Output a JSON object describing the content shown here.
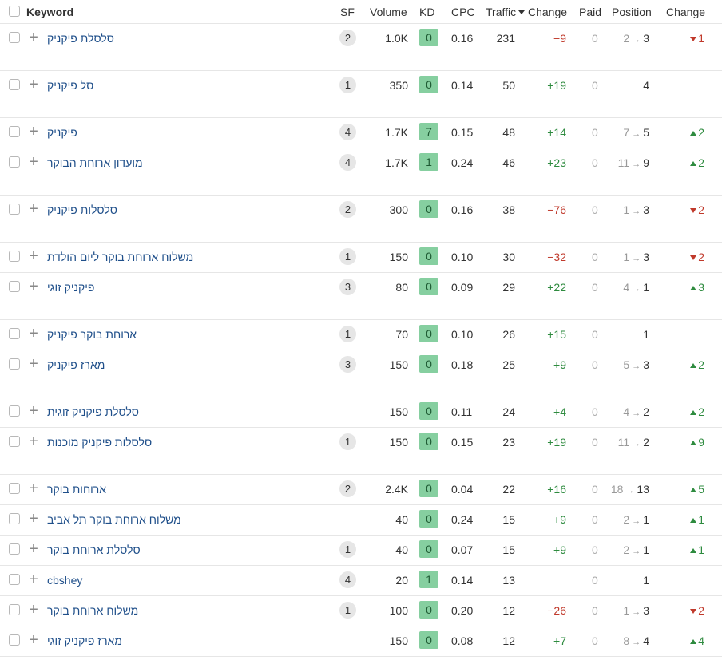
{
  "headers": {
    "keyword": "Keyword",
    "sf": "SF",
    "volume": "Volume",
    "kd": "KD",
    "cpc": "CPC",
    "traffic": "Traffic",
    "change": "Change",
    "paid": "Paid",
    "position": "Position",
    "position_change": "Change"
  },
  "colors": {
    "kd_badge": "#86cfa0",
    "positive": "#2e8b3f",
    "negative": "#c0392b",
    "link": "#1f4f8a"
  },
  "rows": [
    {
      "keyword": "סלסלת פיקניק",
      "sf": "2",
      "volume": "1.0K",
      "kd": "0",
      "cpc": "0.16",
      "traffic": "231",
      "change": "−9",
      "change_dir": "neg",
      "paid": "0",
      "pos_old": "2",
      "pos_new": "3",
      "pos_change": "1",
      "pos_change_dir": "down",
      "height": 59
    },
    {
      "keyword": "סל פיקניק",
      "sf": "1",
      "volume": "350",
      "kd": "0",
      "cpc": "0.14",
      "traffic": "50",
      "change": "+19",
      "change_dir": "pos",
      "paid": "0",
      "pos_old": "",
      "pos_new": "4",
      "pos_change": "",
      "pos_change_dir": "",
      "height": 59
    },
    {
      "keyword": "פיקניק",
      "sf": "4",
      "volume": "1.7K",
      "kd": "7",
      "cpc": "0.15",
      "traffic": "48",
      "change": "+14",
      "change_dir": "pos",
      "paid": "0",
      "pos_old": "7",
      "pos_new": "5",
      "pos_change": "2",
      "pos_change_dir": "up",
      "height": 38
    },
    {
      "keyword": "מועדון ארוחת הבוקר",
      "sf": "4",
      "volume": "1.7K",
      "kd": "1",
      "cpc": "0.24",
      "traffic": "46",
      "change": "+23",
      "change_dir": "pos",
      "paid": "0",
      "pos_old": "11",
      "pos_new": "9",
      "pos_change": "2",
      "pos_change_dir": "up",
      "height": 59
    },
    {
      "keyword": "סלסלות פיקניק",
      "sf": "2",
      "volume": "300",
      "kd": "0",
      "cpc": "0.16",
      "traffic": "38",
      "change": "−76",
      "change_dir": "neg",
      "paid": "0",
      "pos_old": "1",
      "pos_new": "3",
      "pos_change": "2",
      "pos_change_dir": "down",
      "height": 59
    },
    {
      "keyword": "משלוח ארוחת בוקר ליום הולדת",
      "sf": "1",
      "volume": "150",
      "kd": "0",
      "cpc": "0.10",
      "traffic": "30",
      "change": "−32",
      "change_dir": "neg",
      "paid": "0",
      "pos_old": "1",
      "pos_new": "3",
      "pos_change": "2",
      "pos_change_dir": "down",
      "height": 38
    },
    {
      "keyword": "פיקניק זוגי",
      "sf": "3",
      "volume": "80",
      "kd": "0",
      "cpc": "0.09",
      "traffic": "29",
      "change": "+22",
      "change_dir": "pos",
      "paid": "0",
      "pos_old": "4",
      "pos_new": "1",
      "pos_change": "3",
      "pos_change_dir": "up",
      "height": 59
    },
    {
      "keyword": "ארוחת בוקר פיקניק",
      "sf": "1",
      "volume": "70",
      "kd": "0",
      "cpc": "0.10",
      "traffic": "26",
      "change": "+15",
      "change_dir": "pos",
      "paid": "0",
      "pos_old": "",
      "pos_new": "1",
      "pos_change": "",
      "pos_change_dir": "",
      "height": 38
    },
    {
      "keyword": "מארז פיקניק",
      "sf": "3",
      "volume": "150",
      "kd": "0",
      "cpc": "0.18",
      "traffic": "25",
      "change": "+9",
      "change_dir": "pos",
      "paid": "0",
      "pos_old": "5",
      "pos_new": "3",
      "pos_change": "2",
      "pos_change_dir": "up",
      "height": 59
    },
    {
      "keyword": "סלסלת פיקניק זוגית",
      "sf": "",
      "volume": "150",
      "kd": "0",
      "cpc": "0.11",
      "traffic": "24",
      "change": "+4",
      "change_dir": "pos",
      "paid": "0",
      "pos_old": "4",
      "pos_new": "2",
      "pos_change": "2",
      "pos_change_dir": "up",
      "height": 38
    },
    {
      "keyword": "סלסלות פיקניק מוכנות",
      "sf": "1",
      "volume": "150",
      "kd": "0",
      "cpc": "0.15",
      "traffic": "23",
      "change": "+19",
      "change_dir": "pos",
      "paid": "0",
      "pos_old": "11",
      "pos_new": "2",
      "pos_change": "9",
      "pos_change_dir": "up",
      "height": 59
    },
    {
      "keyword": "ארוחות בוקר",
      "sf": "2",
      "volume": "2.4K",
      "kd": "0",
      "cpc": "0.04",
      "traffic": "22",
      "change": "+16",
      "change_dir": "pos",
      "paid": "0",
      "pos_old": "18",
      "pos_new": "13",
      "pos_change": "5",
      "pos_change_dir": "up",
      "height": 38
    },
    {
      "keyword": "משלוח ארוחת בוקר תל אביב",
      "sf": "",
      "volume": "40",
      "kd": "0",
      "cpc": "0.24",
      "traffic": "15",
      "change": "+9",
      "change_dir": "pos",
      "paid": "0",
      "pos_old": "2",
      "pos_new": "1",
      "pos_change": "1",
      "pos_change_dir": "up",
      "height": 38
    },
    {
      "keyword": "סלסלת ארוחת בוקר",
      "sf": "1",
      "volume": "40",
      "kd": "0",
      "cpc": "0.07",
      "traffic": "15",
      "change": "+9",
      "change_dir": "pos",
      "paid": "0",
      "pos_old": "2",
      "pos_new": "1",
      "pos_change": "1",
      "pos_change_dir": "up",
      "height": 38
    },
    {
      "keyword": "cbshey",
      "sf": "4",
      "volume": "20",
      "kd": "1",
      "cpc": "0.14",
      "traffic": "13",
      "change": "",
      "change_dir": "",
      "paid": "0",
      "pos_old": "",
      "pos_new": "1",
      "pos_change": "",
      "pos_change_dir": "",
      "height": 38
    },
    {
      "keyword": "משלוח ארוחת בוקר",
      "sf": "1",
      "volume": "100",
      "kd": "0",
      "cpc": "0.20",
      "traffic": "12",
      "change": "−26",
      "change_dir": "neg",
      "paid": "0",
      "pos_old": "1",
      "pos_new": "3",
      "pos_change": "2",
      "pos_change_dir": "down",
      "height": 38
    },
    {
      "keyword": "מארז פיקניק זוגי",
      "sf": "",
      "volume": "150",
      "kd": "0",
      "cpc": "0.08",
      "traffic": "12",
      "change": "+7",
      "change_dir": "pos",
      "paid": "0",
      "pos_old": "8",
      "pos_new": "4",
      "pos_change": "4",
      "pos_change_dir": "up",
      "height": 38
    }
  ]
}
